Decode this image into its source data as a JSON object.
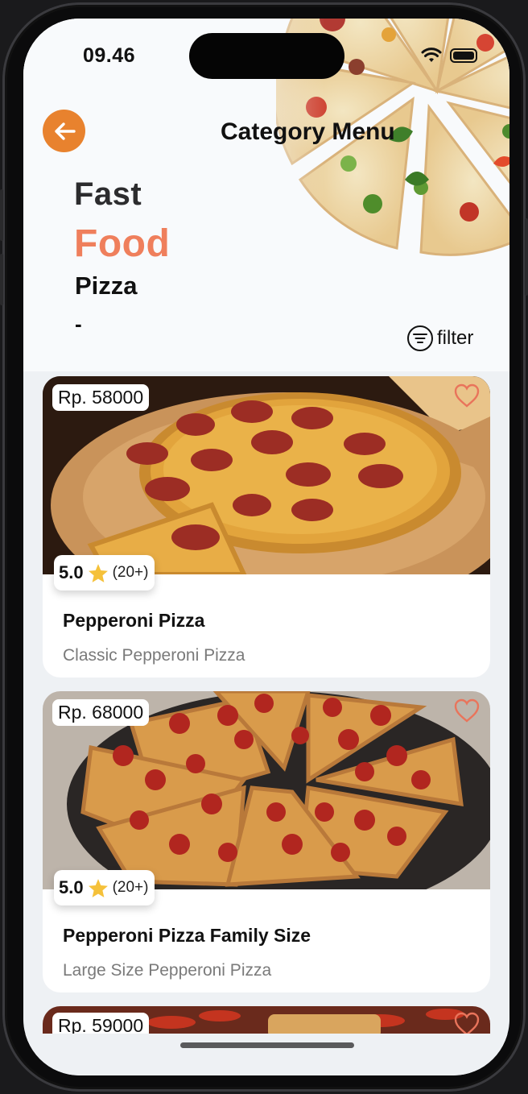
{
  "status_bar": {
    "time": "09.46"
  },
  "header": {
    "title": "Category Menu",
    "line1": "Fast",
    "line2": "Food",
    "category": "Pizza",
    "subtitle": "-",
    "filter_label": "filter"
  },
  "colors": {
    "accent_orange": "#e8822e",
    "food_text": "#ef7f5c",
    "heart": "#e9745b",
    "star": "#f5c13a"
  },
  "menu_items": [
    {
      "price": "Rp. 58000",
      "rating": "5.0",
      "rating_count": "(20+)",
      "name": "Pepperoni Pizza",
      "description": "Classic Pepperoni Pizza"
    },
    {
      "price": "Rp. 68000",
      "rating": "5.0",
      "rating_count": "(20+)",
      "name": "Pepperoni Pizza Family Size",
      "description": "Large Size Pepperoni Pizza"
    },
    {
      "price": "Rp. 59000"
    }
  ]
}
